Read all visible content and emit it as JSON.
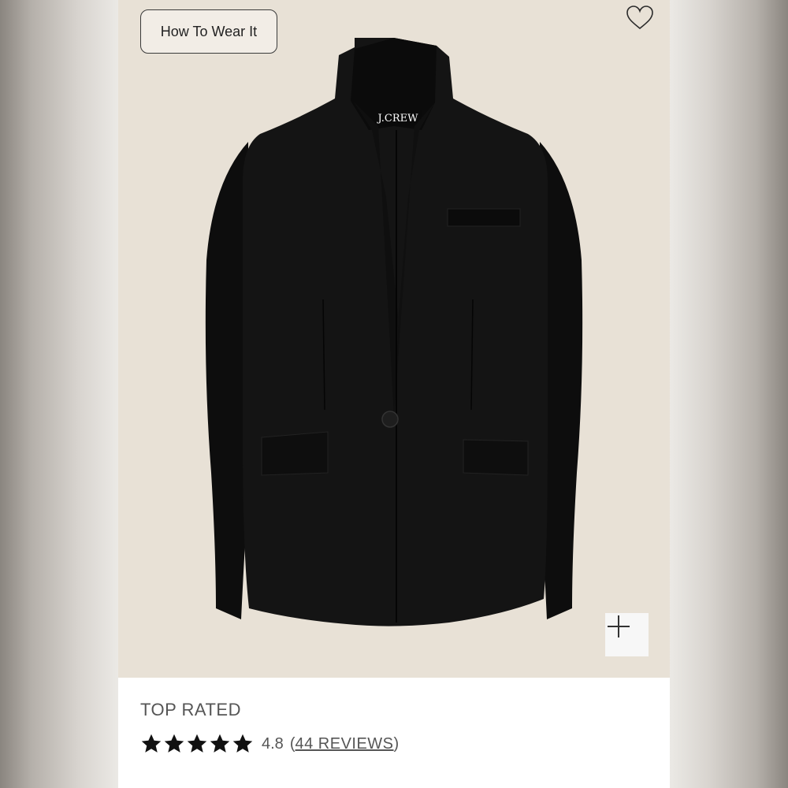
{
  "product": {
    "image_alt": "Black blazer",
    "brand_label": "J.CREW",
    "how_to_wear_label": "How To Wear It",
    "favorite_icon": "heart-outline-icon",
    "zoom_icon": "plus-icon"
  },
  "info": {
    "badge": "TOP RATED",
    "stars": 5,
    "rating": "4.8",
    "reviews_open": "(",
    "reviews_label": "44 REVIEWS",
    "reviews_close": ")"
  },
  "colors": {
    "image_background": "#e8e1d6",
    "jacket": "#111111",
    "text": "#555555",
    "star": "#111111"
  }
}
